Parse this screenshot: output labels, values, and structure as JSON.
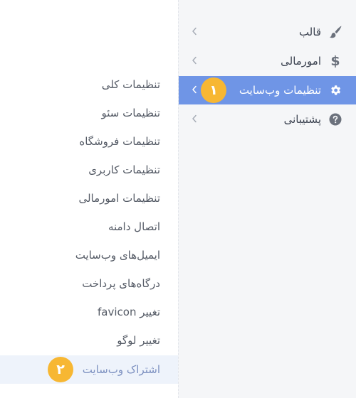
{
  "sidebar": {
    "items": [
      {
        "label": "قالب",
        "icon": "brush-icon"
      },
      {
        "label": "امورمالی",
        "icon": "dollar-icon"
      },
      {
        "label": "تنظیمات وب‌سایت",
        "icon": "gear-icon",
        "active": true
      },
      {
        "label": "پشتیبانی",
        "icon": "help-circle-icon"
      }
    ],
    "active_color": "#6f95e6"
  },
  "submenu": {
    "items": [
      {
        "label": "تنظیمات کلی"
      },
      {
        "label": "تنظیمات سئو"
      },
      {
        "label": "تنظیمات فروشگاه"
      },
      {
        "label": "تنظیمات کاربری"
      },
      {
        "label": "تنظیمات امورمالی"
      },
      {
        "label": "اتصال دامنه"
      },
      {
        "label": "ایمیل‌های وب‌سایت"
      },
      {
        "label": "درگاه‌های پرداخت"
      },
      {
        "label": "تغییر favicon"
      },
      {
        "label": "تغییر لوگو"
      },
      {
        "label": "اشتراک وب‌سایت",
        "active": true
      }
    ]
  },
  "callouts": {
    "one": "۱",
    "two": "۲",
    "color": "#f7b733"
  }
}
